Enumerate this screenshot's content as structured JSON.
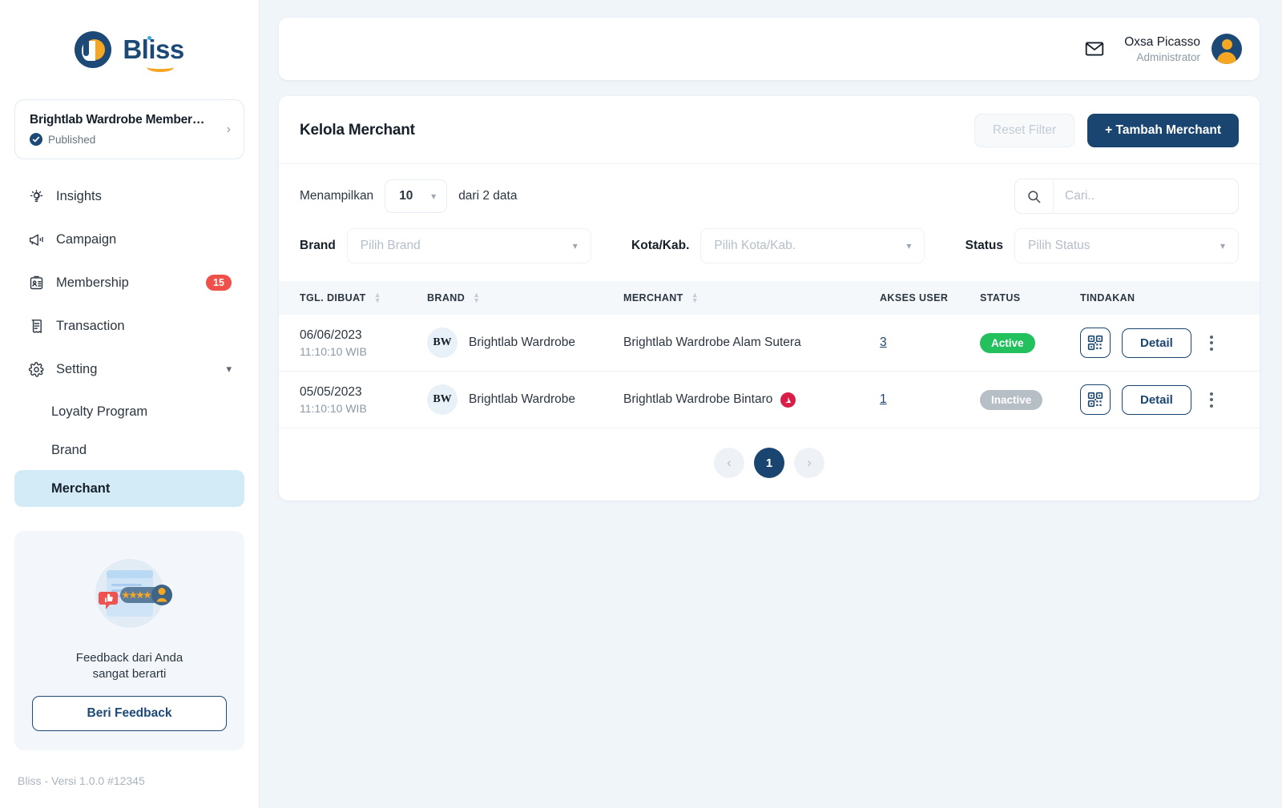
{
  "brand": {
    "logo_text": "Bliss",
    "navy": "#1b4571",
    "accent_orange": "#f5a623",
    "accent_blue": "#39a9e0"
  },
  "sidebar": {
    "project": {
      "title": "Brightlab Wardrobe Member…",
      "status": "Published",
      "verified_icon": "verified-check-icon",
      "chevron_icon": "chevron-right-icon"
    },
    "nav": [
      {
        "label": "Insights",
        "icon": "lightbulb-icon",
        "badge": null,
        "active": false
      },
      {
        "label": "Campaign",
        "icon": "megaphone-icon",
        "badge": null,
        "active": false
      },
      {
        "label": "Membership",
        "icon": "id-card-icon",
        "badge": "15",
        "active": false
      },
      {
        "label": "Transaction",
        "icon": "receipt-icon",
        "badge": null,
        "active": false
      },
      {
        "label": "Setting",
        "icon": "gear-icon",
        "badge": null,
        "active": false,
        "expandable": true
      }
    ],
    "sub_nav": [
      {
        "label": "Loyalty Program",
        "active": false
      },
      {
        "label": "Brand",
        "active": false
      },
      {
        "label": "Merchant",
        "active": true
      }
    ],
    "feedback": {
      "text_line_1": "Feedback dari Anda",
      "text_line_2": "sangat berarti",
      "button_label": "Beri Feedback",
      "illustration_icon": "review-stars-illustration"
    },
    "version": "Bliss - Versi 1.0.0 #12345"
  },
  "topbar": {
    "mail_icon": "envelope-icon",
    "user_name": "Oxsa Picasso",
    "user_role": "Administrator",
    "avatar_icon": "user-avatar-icon"
  },
  "panel": {
    "title": "Kelola Merchant",
    "reset_label": "Reset Filter",
    "add_label": "+ Tambah Merchant"
  },
  "filters": {
    "showing_label": "Menampilkan",
    "page_size": "10",
    "total_label": "dari 2 data",
    "search_placeholder": "Cari..",
    "search_value": "",
    "search_icon": "search-icon",
    "brand_label": "Brand",
    "brand_placeholder": "Pilih Brand",
    "kota_label": "Kota/Kab.",
    "kota_placeholder": "Pilih Kota/Kab.",
    "status_label": "Status",
    "status_placeholder": "Pilih Status",
    "chevron_icon": "chevron-down-icon"
  },
  "table": {
    "columns": [
      {
        "label": "TGL. DIBUAT",
        "sortable": true
      },
      {
        "label": "BRAND",
        "sortable": true
      },
      {
        "label": "MERCHANT",
        "sortable": true
      },
      {
        "label": "AKSES USER",
        "sortable": false
      },
      {
        "label": "STATUS",
        "sortable": false
      },
      {
        "label": "TINDAKAN",
        "sortable": false
      }
    ],
    "rows": [
      {
        "date": "06/06/2023",
        "time": "11:10:10 WIB",
        "brand_initials": "BW",
        "brand_name": "Brightlab Wardrobe",
        "merchant": "Brightlab Wardrobe Alam Sutera",
        "merchant_warning": false,
        "akses_user": "3",
        "status": "Active",
        "status_type": "active",
        "qr_icon": "qr-code-icon",
        "detail_label": "Detail",
        "kebab_icon": "more-vertical-icon"
      },
      {
        "date": "05/05/2023",
        "time": "11:10:10 WIB",
        "brand_initials": "BW",
        "brand_name": "Brightlab Wardrobe",
        "merchant": "Brightlab Wardrobe Bintaro",
        "merchant_warning": true,
        "warning_icon": "warning-circle-icon",
        "akses_user": "1",
        "status": "Inactive",
        "status_type": "inactive",
        "qr_icon": "qr-code-icon",
        "detail_label": "Detail",
        "kebab_icon": "more-vertical-icon"
      }
    ]
  },
  "pagination": {
    "prev_icon": "chevron-left-icon",
    "next_icon": "chevron-right-icon",
    "current_page": "1"
  },
  "colors": {
    "status_active": "#23c05e",
    "status_inactive": "#b6bec6",
    "badge_red": "#f0504a",
    "warning_red": "#d81e46",
    "active_nav_bg": "#d3eaf7",
    "page_bg": "#f0f5fa"
  }
}
